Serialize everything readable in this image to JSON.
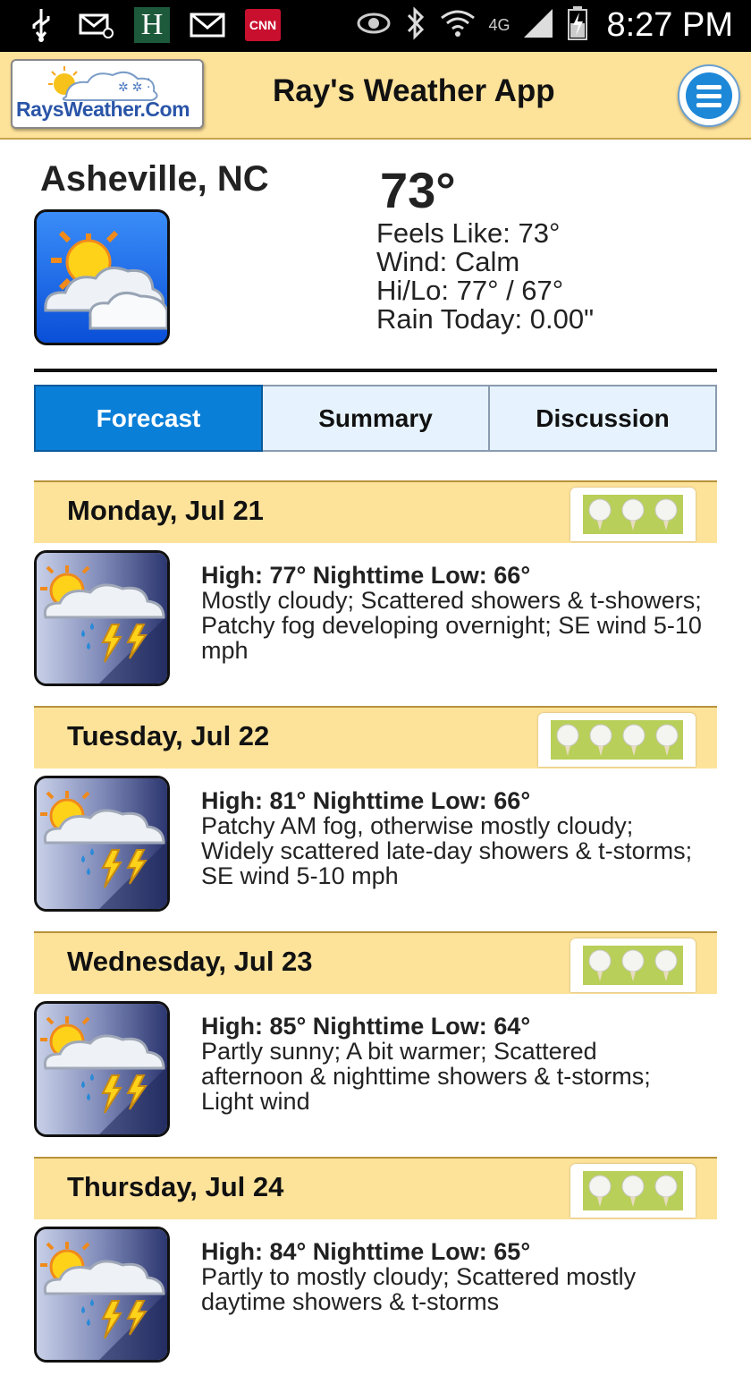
{
  "status_bar": {
    "time": "8:27 PM",
    "network": "4G",
    "left_icons": [
      "usb-icon",
      "email-icon",
      "h-app-icon",
      "gmail-icon",
      "cnn-icon"
    ],
    "right_icons": [
      "eye-icon",
      "bluetooth-icon",
      "wifi-icon",
      "signal-icon",
      "battery-icon"
    ]
  },
  "header": {
    "logo_text": "RaysWeather.Com",
    "title": "Ray's Weather App",
    "menu_icon": "menu-icon"
  },
  "current": {
    "city": "Asheville, NC",
    "temp": "73°",
    "feels_like": "Feels Like: 73°",
    "wind": "Wind: Calm",
    "hilo": "Hi/Lo: 77° / 67°",
    "rain": "Rain Today: 0.00\"",
    "icon": "partly-cloudy-icon"
  },
  "tabs": [
    {
      "label": "Forecast",
      "active": true
    },
    {
      "label": "Summary",
      "active": false
    },
    {
      "label": "Discussion",
      "active": false
    }
  ],
  "forecast": [
    {
      "day": "Monday, Jul 21",
      "hilo": "High: 77° Nighttime Low: 66°",
      "desc": "Mostly cloudy; Scattered showers & t-showers; Patchy fog developing overnight; SE wind 5-10 mph",
      "golf_balls": 3,
      "icon": "thunderstorm-icon"
    },
    {
      "day": "Tuesday, Jul 22",
      "hilo": "High: 81° Nighttime Low: 66°",
      "desc": "Patchy AM fog, otherwise mostly cloudy; Widely scattered late-day showers & t-storms; SE wind 5-10 mph",
      "golf_balls": 4,
      "icon": "thunderstorm-icon"
    },
    {
      "day": "Wednesday, Jul 23",
      "hilo": "High: 85° Nighttime Low: 64°",
      "desc": "Partly sunny; A bit warmer; Scattered afternoon & nighttime showers & t-storms; Light wind",
      "golf_balls": 3,
      "icon": "thunderstorm-icon"
    },
    {
      "day": "Thursday, Jul 24",
      "hilo": "High: 84° Nighttime Low: 65°",
      "desc": "Partly to mostly cloudy; Scattered mostly daytime showers & t-storms",
      "golf_balls": 3,
      "icon": "thunderstorm-icon"
    }
  ],
  "colors": {
    "header_bg": "#fde29a",
    "tab_active": "#0a7fd8",
    "tab_inactive": "#e6f3ff"
  }
}
